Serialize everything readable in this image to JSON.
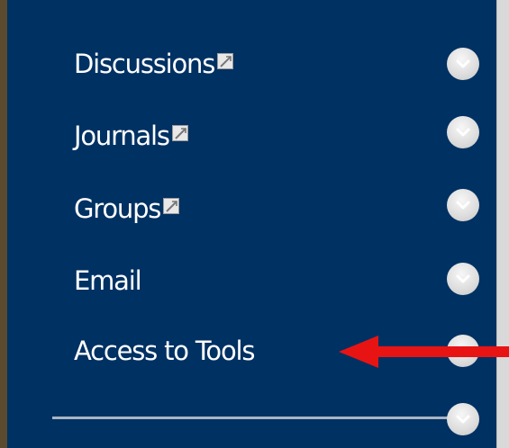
{
  "menu": {
    "items": [
      {
        "label": "Discussions",
        "icon": "external-link-icon"
      },
      {
        "label": "Journals",
        "icon": "external-link-icon"
      },
      {
        "label": "Groups",
        "icon": "external-link-icon"
      },
      {
        "label": "Email"
      },
      {
        "label": "Access to Tools"
      }
    ],
    "chevron_icon": "chevron-down-icon"
  },
  "annotation": {
    "type": "arrow",
    "color": "#e81414",
    "points_to": "Access to Tools"
  },
  "colors": {
    "panel_background": "#003163",
    "text": "#ffffff",
    "left_border": "#5b4a2e",
    "right_strip": "#d9d9d9"
  }
}
